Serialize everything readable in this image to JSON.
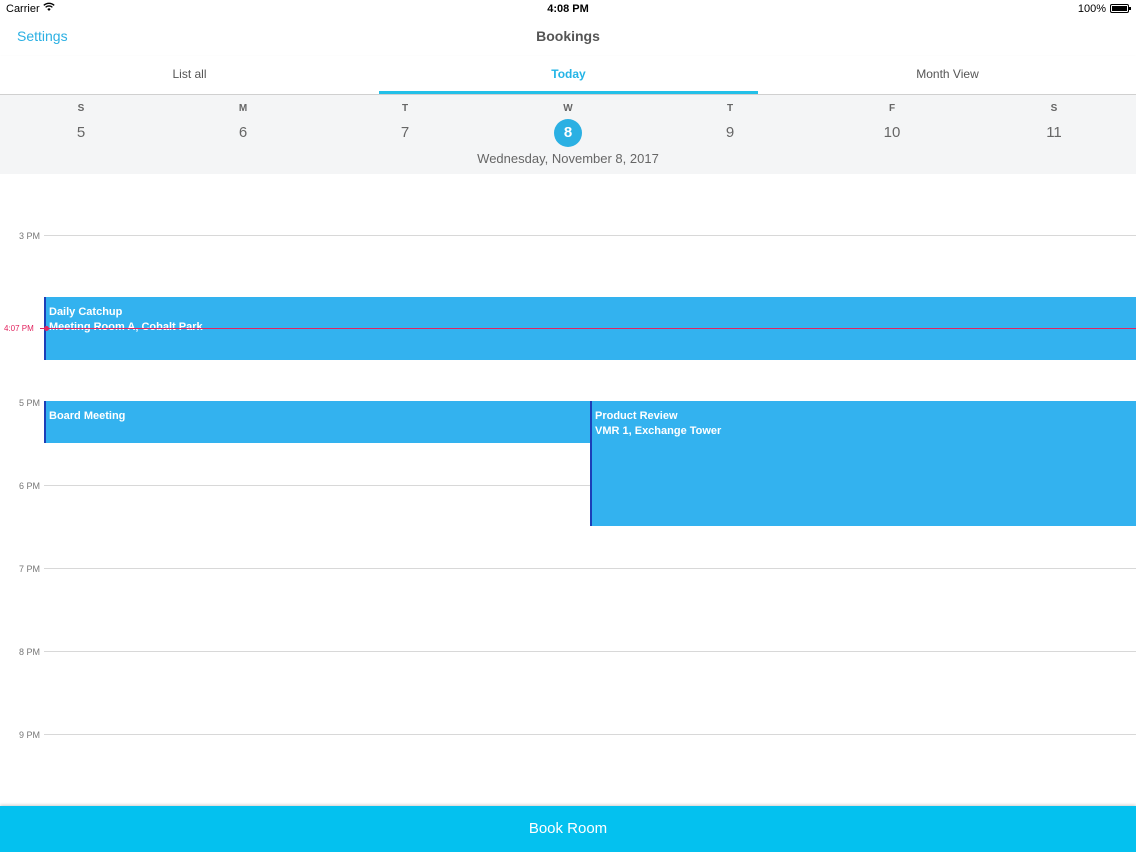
{
  "status_bar": {
    "carrier": "Carrier",
    "wifi_icon": "wifi-icon",
    "time": "4:08 PM",
    "battery": "100%",
    "battery_icon": "battery-icon"
  },
  "nav": {
    "settings": "Settings",
    "title": "Bookings"
  },
  "tabs": [
    {
      "label": "List all"
    },
    {
      "label": "Today",
      "active": true
    },
    {
      "label": "Month View"
    }
  ],
  "week": {
    "days": [
      {
        "letter": "S",
        "num": "5"
      },
      {
        "letter": "M",
        "num": "6"
      },
      {
        "letter": "T",
        "num": "7"
      },
      {
        "letter": "W",
        "num": "8",
        "selected": true
      },
      {
        "letter": "T",
        "num": "9"
      },
      {
        "letter": "F",
        "num": "10"
      },
      {
        "letter": "S",
        "num": "11"
      }
    ],
    "full_date": "Wednesday, November 8, 2017"
  },
  "timeline": {
    "hours": [
      "3 PM",
      "5 PM",
      "6 PM",
      "7 PM",
      "8 PM",
      "9 PM"
    ],
    "now_label": "4:07 PM",
    "events": [
      {
        "title": "Daily Catchup",
        "location": "Meeting Room A, Cobalt Park"
      },
      {
        "title": "Board Meeting",
        "location": ""
      },
      {
        "title": "Product Review",
        "location": "VMR 1, Exchange Tower"
      }
    ]
  },
  "colors": {
    "accent": "#2bb0e3",
    "event": "#33b2ef",
    "event_border": "#1c3fb8",
    "now": "#e2245f",
    "book_bar": "#04c1ef"
  },
  "book_button": "Book Room"
}
